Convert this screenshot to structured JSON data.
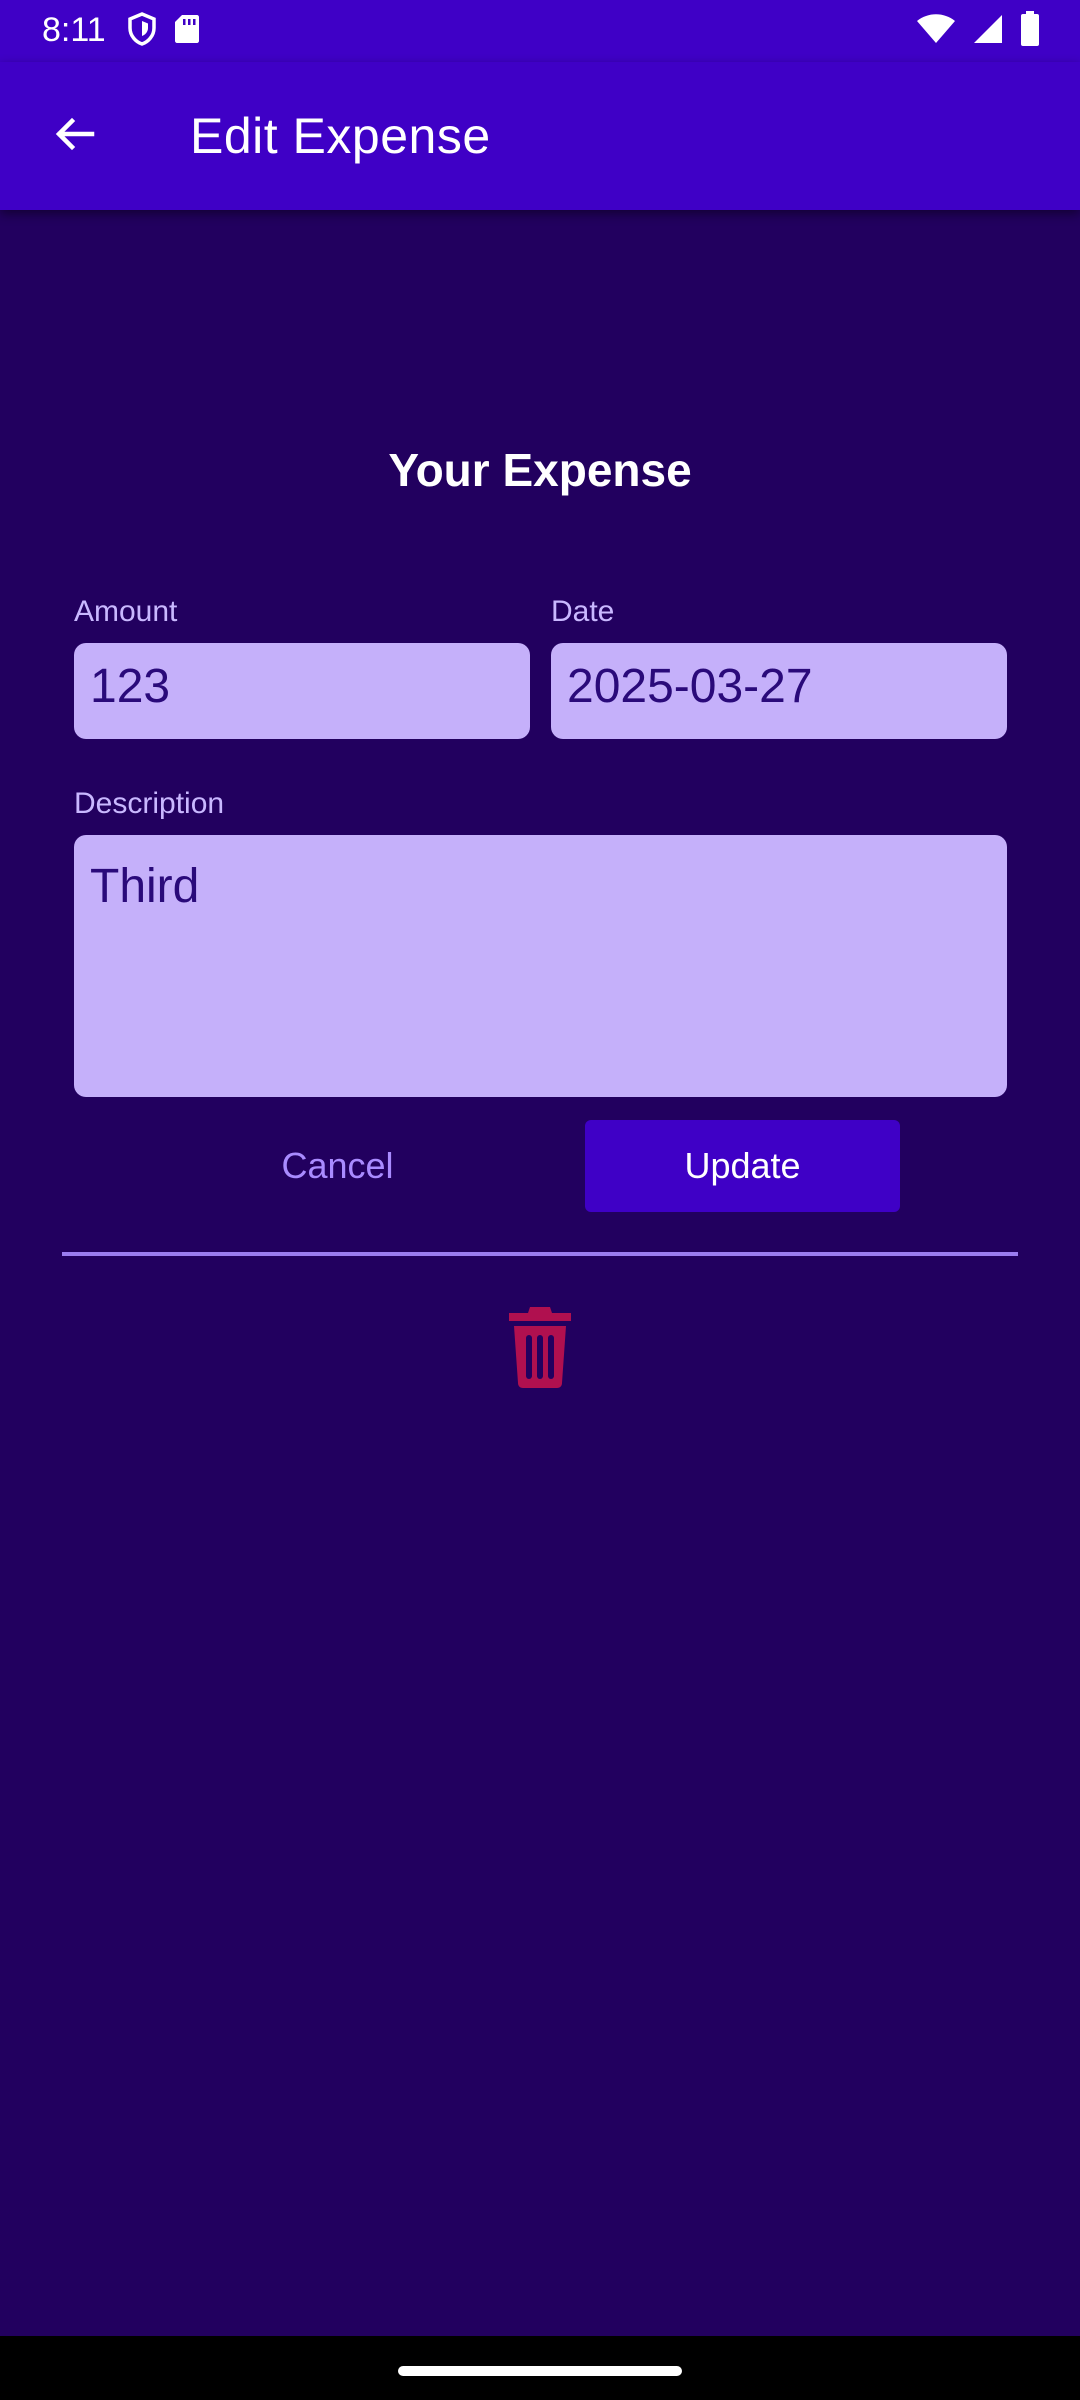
{
  "status_bar": {
    "time": "8:11",
    "left_icons": [
      "shield-icon",
      "sd-card-icon"
    ],
    "right_icons": [
      "wifi-icon",
      "signal-icon",
      "battery-icon"
    ]
  },
  "app_bar": {
    "title": "Edit Expense",
    "back_icon": "arrow-back-icon"
  },
  "form": {
    "title": "Your Expense",
    "amount": {
      "label": "Amount",
      "value": "123"
    },
    "date": {
      "label": "Date",
      "value": "2025-03-27"
    },
    "description": {
      "label": "Description",
      "value": "Third"
    }
  },
  "actions": {
    "cancel_label": "Cancel",
    "update_label": "Update",
    "delete_icon": "trash-icon"
  },
  "colors": {
    "app_bar": "#3f00c6",
    "background": "#22005f",
    "field_background": "#c5b0fa",
    "field_text": "#2a0a7a",
    "delete": "#b0104f",
    "divider": "#9b7cf0"
  }
}
